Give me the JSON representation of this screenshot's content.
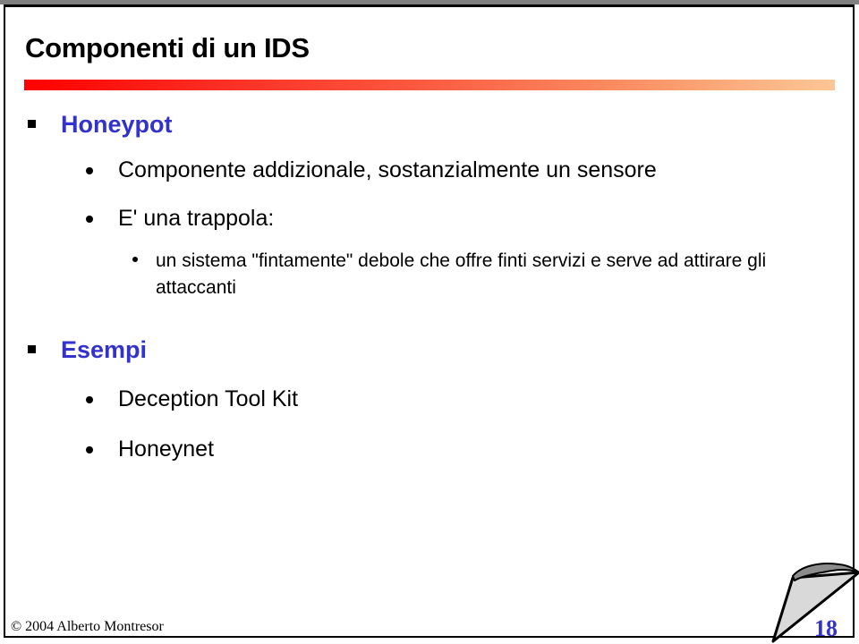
{
  "slide": {
    "title": "Componenti di un IDS",
    "page_number": "18",
    "copyright": "© 2004 Alberto Montresor",
    "colors": {
      "heading_blue": "#3333cc",
      "body_black": "#000000",
      "rule_gradient_start": "#ff0000",
      "rule_gradient_end": "#fcc694",
      "top_band_gray": "#808080",
      "corner_fill_gray": "#d9d9d9",
      "corner_curl_gray": "#8c8c8c"
    },
    "icons": {
      "bullet_level1": "square-bullet-icon",
      "bullet_level2": "round-bullet-icon",
      "bullet_level3": "small-round-bullet-icon",
      "corner": "page-curl-icon"
    },
    "body": [
      {
        "level": 1,
        "text": "Honeypot"
      },
      {
        "level": 2,
        "text": "Componente addizionale, sostanzialmente un sensore"
      },
      {
        "level": 2,
        "text": "E' una trappola:"
      },
      {
        "level": 3,
        "text": "un sistema \"fintamente\" debole che offre finti servizi e serve ad attirare gli attaccanti"
      },
      {
        "level": 1,
        "text": "Esempi"
      },
      {
        "level": 2,
        "text": "Deception Tool Kit"
      },
      {
        "level": 2,
        "text": "Honeynet"
      }
    ]
  }
}
